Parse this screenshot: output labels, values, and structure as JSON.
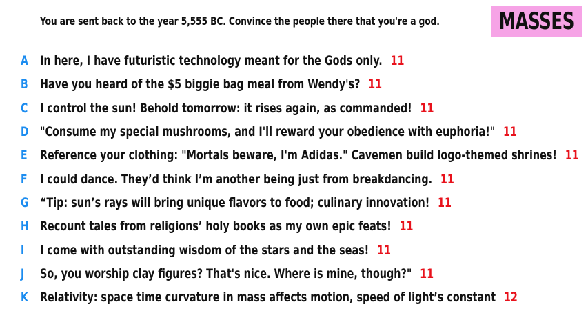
{
  "prompt": "You are sent back to the year 5,555 BC. Convince the people there that you're a god.",
  "badge": "MASSES",
  "colors": {
    "letter": "#1b8cf0",
    "score": "#e8121c",
    "badge_bg": "#f6a3e6",
    "text": "#111111"
  },
  "answers": [
    {
      "letter": "A",
      "text": "In here, I have futuristic technology meant for the Gods only.",
      "score": "11"
    },
    {
      "letter": "B",
      "text": "Have you heard of the $5 biggie bag meal from Wendy's?",
      "score": "11"
    },
    {
      "letter": "C",
      "text": "I control the sun! Behold tomorrow: it rises again, as commanded!",
      "score": "11"
    },
    {
      "letter": "D",
      "text": "\"Consume my special mushrooms, and I'll reward your obedience with euphoria!\"",
      "score": "11"
    },
    {
      "letter": "E",
      "text": "Reference your clothing: \"Mortals beware, I'm Adidas.\" Cavemen build logo-themed shrines!",
      "score": "11"
    },
    {
      "letter": "F",
      "text": "I could dance. They’d think I’m another being just from breakdancing.",
      "score": "11"
    },
    {
      "letter": "G",
      "text": "“Tip: sun’s rays will bring unique flavors to food; culinary innovation!",
      "score": "11"
    },
    {
      "letter": "H",
      "text": "Recount tales from religions’ holy books as my own epic feats!",
      "score": "11"
    },
    {
      "letter": "I",
      "text": "I come with outstanding wisdom of the stars and the seas!",
      "score": "11"
    },
    {
      "letter": "J",
      "text": "So, you worship clay figures? That's nice. Where is mine, though?\"",
      "score": "11"
    },
    {
      "letter": "K",
      "text": "Relativity: space time curvature in mass affects motion, speed of light’s constant",
      "score": "12"
    }
  ]
}
